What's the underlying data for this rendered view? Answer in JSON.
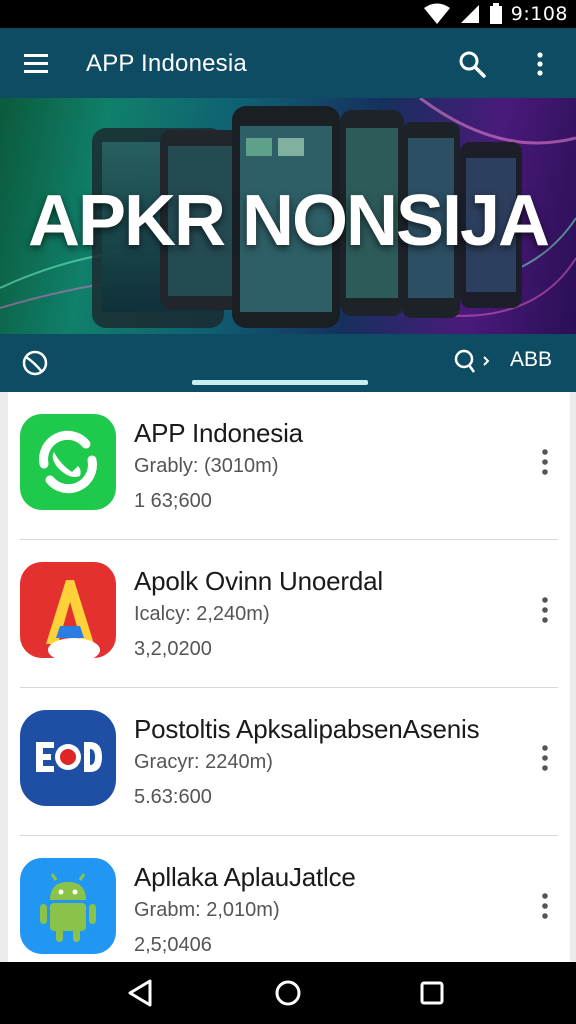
{
  "status_bar": {
    "time": "9:108",
    "icons": [
      "wifi-icon",
      "signal-icon",
      "battery-icon"
    ]
  },
  "app_bar": {
    "title": "APP Indonesia",
    "icons": [
      "menu-icon",
      "search-icon",
      "more-vert-icon"
    ],
    "color": "#0e4c63"
  },
  "banner": {
    "text": "APKR NONSIJA"
  },
  "tab_strip": {
    "label": "ABB",
    "icons": [
      "globe-icon",
      "search-icon",
      "chevron-right-icon"
    ],
    "indicator_color": "#c9eef0"
  },
  "apps": [
    {
      "name": "APP Indonesia",
      "category": "Grably: (3010m)",
      "count": "1 63;600",
      "icon": "phone-refresh-icon",
      "icon_color": "#1ec94b"
    },
    {
      "name": "Apolk Ovinn Unoerdal",
      "category": "Icalcy: 2,240m)",
      "count": "3,2,0200",
      "icon": "letter-a-icon",
      "icon_color": "#e53030"
    },
    {
      "name": "Postoltis ApksalipabsenAsenis",
      "category": "Gracyr: 2240m)",
      "count": "5.63:600",
      "icon": "eod-icon",
      "icon_color": "#1f4fa5"
    },
    {
      "name": "Apllaka AplauJatlce",
      "category": "Grabm: 2,010m)",
      "count": "2,5;0406",
      "icon": "android-icon",
      "icon_color": "#2196f3"
    }
  ],
  "nav_bar": {
    "icons": [
      "back-icon",
      "home-icon",
      "recents-icon"
    ]
  }
}
